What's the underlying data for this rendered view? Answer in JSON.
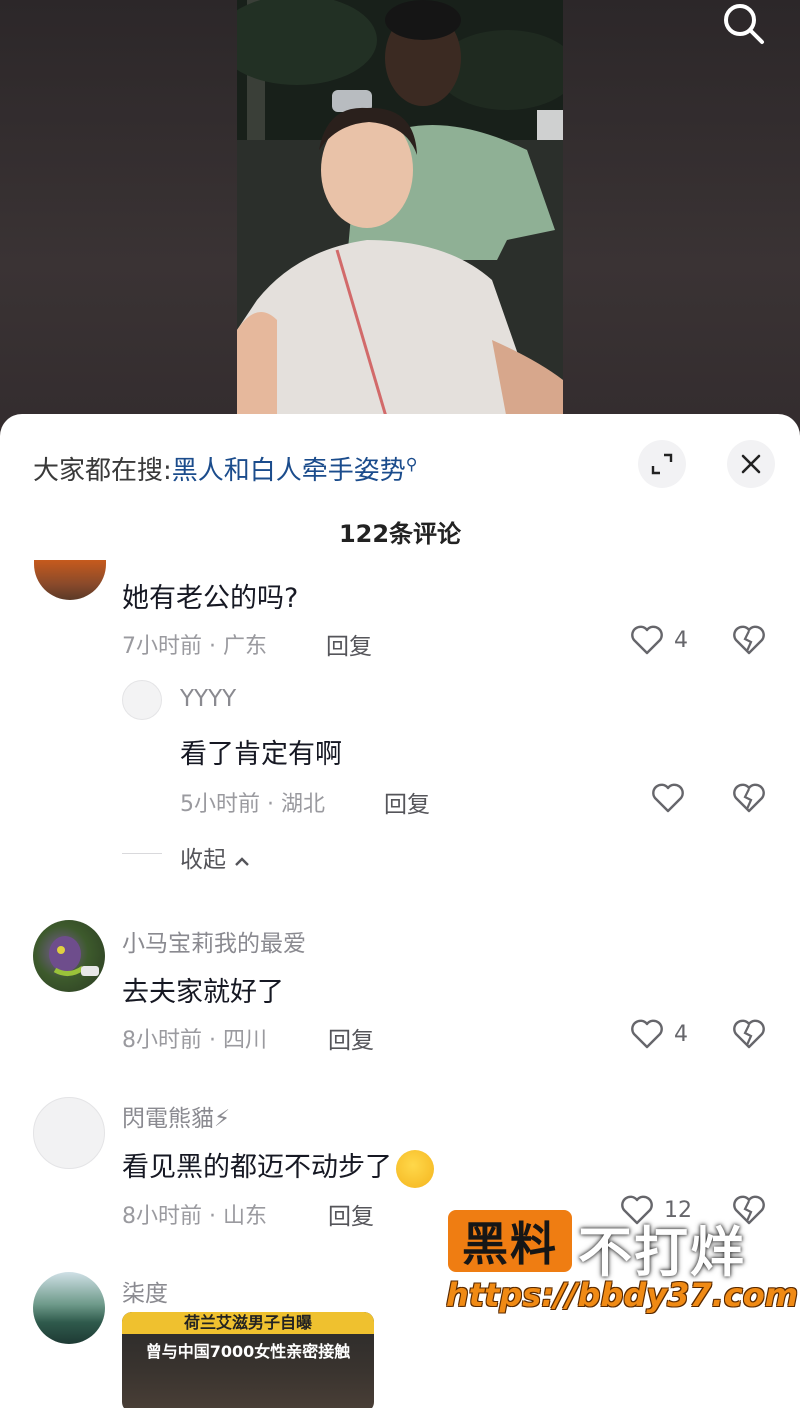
{
  "header": {
    "hot_search_label": "大家都在搜:",
    "hot_search_keyword": "黑人和白人牵手姿势",
    "comment_count": "122条评论"
  },
  "comments": [
    {
      "username": "",
      "text": "她有老公的吗?",
      "meta": "7小时前 · 广东",
      "reply": "回复",
      "likes": "4"
    },
    {
      "username": "YYYY",
      "text": "看了肯定有啊",
      "meta": "5小时前 · 湖北",
      "reply": "回复",
      "likes": ""
    },
    {
      "username": "小马宝莉我的最爱",
      "text": "去夫家就好了",
      "meta": "8小时前 · 四川",
      "reply": "回复",
      "likes": "4"
    },
    {
      "username": "閃電熊貓⚡",
      "text": "看见黑的都迈不动步了",
      "meta": "8小时前 · 山东",
      "reply": "回复",
      "likes": "12"
    },
    {
      "username": "柒度",
      "thumb_top": "荷兰艾滋男子自曝",
      "thumb_sub": "曾与中国7000女性亲密接触"
    }
  ],
  "collapse_label": "收起",
  "watermark": {
    "badge": "黑料",
    "text": "不打烊",
    "url": "https://bbdy37.com"
  },
  "colors": {
    "sheet_bg": "#ffffff",
    "keyword": "#1b4c8c",
    "watermark_orange": "#ef7d12"
  }
}
